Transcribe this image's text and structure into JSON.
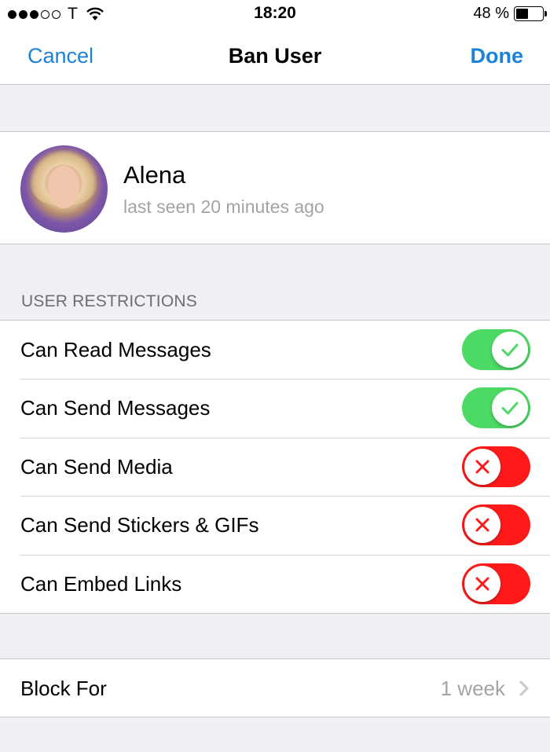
{
  "status_bar": {
    "carrier": "T",
    "time": "18:20",
    "battery_percent": "48 %",
    "battery_level": 0.48,
    "signal_bars": 3,
    "signal_total": 5
  },
  "nav": {
    "cancel_label": "Cancel",
    "title": "Ban User",
    "done_label": "Done"
  },
  "profile": {
    "name": "Alena",
    "status": "last seen 20 minutes ago"
  },
  "restrictions": {
    "header": "USER RESTRICTIONS",
    "items": [
      {
        "label": "Can Read Messages",
        "enabled": true
      },
      {
        "label": "Can Send Messages",
        "enabled": true
      },
      {
        "label": "Can Send Media",
        "enabled": false
      },
      {
        "label": "Can Send Stickers & GIFs",
        "enabled": false
      },
      {
        "label": "Can Embed Links",
        "enabled": false
      }
    ]
  },
  "block_for": {
    "label": "Block For",
    "value": "1 week"
  },
  "colors": {
    "accent": "#1a82d9",
    "toggle_on": "#4cd964",
    "toggle_off": "#ff1a1a",
    "background": "#efeff4"
  }
}
